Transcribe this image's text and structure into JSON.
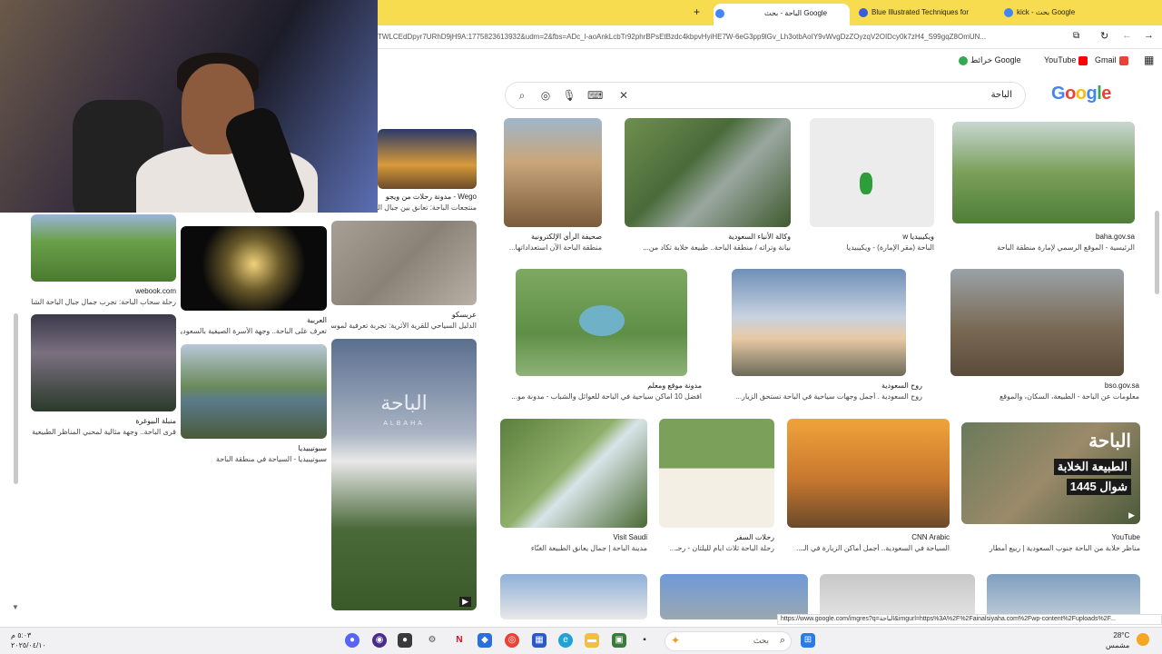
{
  "browser": {
    "tabs": [
      {
        "label": "الباحة - بحث Google",
        "active": true
      },
      {
        "label": "Blue Illustrated Techniques for",
        "active": false
      },
      {
        "label": "kick - بحث Google",
        "active": false
      }
    ],
    "new_tab": "+",
    "url": "TWLCEdDpyr7URhD9jH9A:1775823613932&udm=2&fbs=ADc_l-aoAnkLcbTr92phrBPsEtBzdc4kbpvHyiHE7W-6eG3pp9lGv_Lh3otbAoIY9vWvgDzZOyzqV2OIDcy0k7zH4_S99gqZ8OmUN...",
    "bookmarks": [
      "خرائط Google",
      "YouTube",
      "Gmail"
    ]
  },
  "search": {
    "query": "الباحة",
    "logo": "Google"
  },
  "results_right": [
    {
      "source": "صحيفة الرأي الإلكترونية",
      "caption": "منطقة الباحة الآن استعداداتها..."
    },
    {
      "source": "وكالة الأنباء السعودية",
      "caption": "بيانة وتراثه / منطقة الباحة.. طبيعة خلابة تكاد من..."
    },
    {
      "source": "ويكيبيديا w",
      "caption": "الباحة (مقر الإمارة) - ويكيبيديا"
    },
    {
      "source": "baha.gov.sa",
      "caption": "الرئيسية - الموقع الرسمي لإمارة منطقة الباحة"
    },
    {
      "source": "مدونة موقع ومعلم",
      "caption": "افضل 10 اماكن سياحية في الباحة للعوائل والشباب - مدونة مو..."
    },
    {
      "source": "روح السعودية",
      "caption": "روح السعودية . أجمل وجهات سياحية في الباحة تستحق الزيار..."
    },
    {
      "source": "bso.gov.sa",
      "caption": "معلومات عن الباحة - الطبيعة، السكان، والموقع"
    },
    {
      "source": "Visit Saudi",
      "caption": "مدينة الباحة | جمال يعانق الطبيعة الغنّاء"
    },
    {
      "source": "رحلات السفر",
      "caption": "رحلة الباحة ثلاث ايام لليلتان - رحـ..."
    },
    {
      "source": "CNN Arabic",
      "caption": "السياحة في السعودية.. أجمل أماكن الزيارة في الـ..."
    },
    {
      "source": "YouTube",
      "caption": "مناظر خلابة من الباحة جنوب السعودية | ربيع أمطار"
    }
  ],
  "results_left": [
    {
      "source": "Wego - مدونة رحلات من ويجو",
      "caption": "منتجعات الباحة: تعانق بين جبال الباحة الشاهقة"
    },
    {
      "source": "webook.com",
      "caption": "رحلة سحاب الباحة: تجرب جمال جبال الباحة الشاهقة"
    },
    {
      "source": "العربية",
      "caption": "تعرف على الباحة.. وجهة الأسرة الصيفية بالسعودية"
    },
    {
      "source": "عربسكو",
      "caption": "الدليل السياحي للقرية الأثرية: تجربة تعرفية لموسم سياحي ثرية"
    },
    {
      "source": "منبلة البيوغرة",
      "caption": "قرى الباحة.. وجهة مثالية لمحبي المناظر الطبيعية | مجلة..."
    },
    {
      "source": "سبوتيبيديا",
      "caption": "سبوتيبيديا - السياحة في منطقة الباحة"
    }
  ],
  "left_overlay_text": "الباحة",
  "left_overlay_subtitle": "ALBAHA",
  "youtube_overlay": {
    "line1": "الباحة",
    "line2": "الطبيعة الخلابة",
    "line3": "شوال 1445"
  },
  "status_url": "https://www.google.com/imgres?q=الباحة&imgurl=https%3A%2F%2Fainalsiyaha.com%2Fwp-content%2Fuploads%2F...",
  "taskbar": {
    "search_placeholder": "بحث",
    "weather_temp": "28°C",
    "weather_desc": "مشمس",
    "time": "٥:٠٣ م",
    "date": "٢٠٢٥/٠٤/١٠"
  },
  "colors": {
    "tabbar": "#f7dc4f",
    "google_blue": "#4285f4",
    "google_red": "#ea4335",
    "google_yellow": "#fbbc05",
    "google_green": "#34a853"
  }
}
